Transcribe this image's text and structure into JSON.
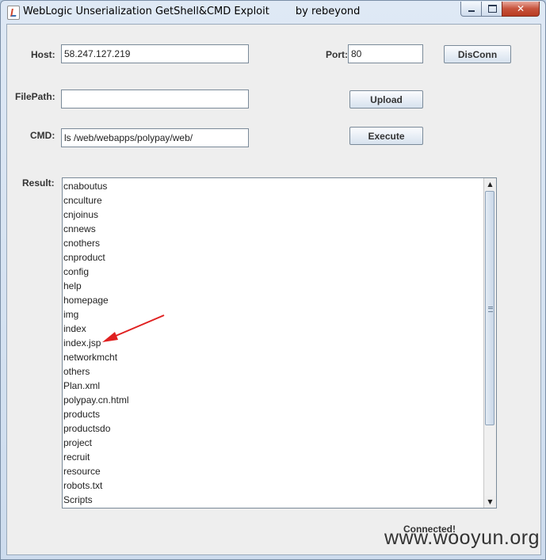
{
  "window": {
    "title": "WebLogic Unserialization GetShell&CMD Exploit        by rebeyond",
    "minimize_icon": "minimize-icon",
    "maximize_icon": "maximize-icon",
    "close_icon": "close-icon",
    "close_glyph": "✕"
  },
  "form": {
    "host_label": "Host:",
    "host_value": "58.247.127.219",
    "port_label": "Port:",
    "port_value": "80",
    "disconnect_label": "DisConn",
    "filepath_label": "FilePath:",
    "filepath_value": "",
    "upload_label": "Upload",
    "cmd_label": "CMD:",
    "cmd_value": "ls /web/webapps/polypay/web/",
    "execute_label": "Execute",
    "result_label": "Result:"
  },
  "result_lines": [
    "cnaboutus",
    "cnculture",
    "cnjoinus",
    "cnnews",
    "cnothers",
    "cnproduct",
    "config",
    "help",
    "homepage",
    "img",
    "index",
    "index.jsp",
    "networkmcht",
    "others",
    "Plan.xml",
    "polypay.cn.html",
    "products",
    "productsdo",
    "project",
    "recruit",
    "resource",
    "robots.txt",
    "Scripts"
  ],
  "scroll": {
    "up_arrow": "▲",
    "down_arrow": "▼"
  },
  "status": "Connected!",
  "watermark": "www.wooyun.org",
  "colors": {
    "annotation_arrow": "#e02020",
    "close_button": "#c7533c"
  }
}
